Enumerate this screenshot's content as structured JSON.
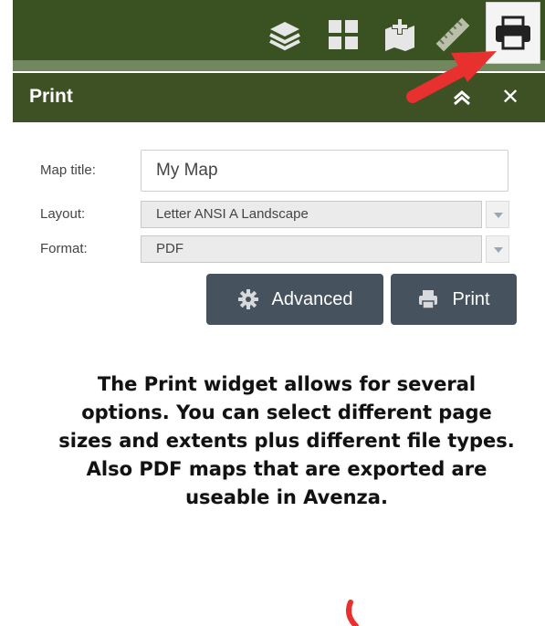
{
  "toolbar": {
    "tools": [
      {
        "icon": "layers-icon"
      },
      {
        "icon": "basemap-gallery-icon"
      },
      {
        "icon": "add-data-icon"
      },
      {
        "icon": "measure-icon"
      },
      {
        "icon": "print-icon",
        "active": true
      }
    ]
  },
  "panel": {
    "title": "Print",
    "fields": {
      "map_title_label": "Map title:",
      "map_title_value": "My Map",
      "layout_label": "Layout:",
      "layout_value": "Letter ANSI A Landscape",
      "format_label": "Format:",
      "format_value": "PDF"
    },
    "buttons": {
      "advanced": "Advanced",
      "print": "Print"
    }
  },
  "annotation": {
    "text": "The Print widget allows for several options. You can select different page sizes and extents plus different file types. Also PDF maps that are exported are useable in Avenza."
  },
  "colors": {
    "header_green": "#3d5125",
    "button_slate": "#46525d",
    "arrow_red": "#e8312f"
  }
}
